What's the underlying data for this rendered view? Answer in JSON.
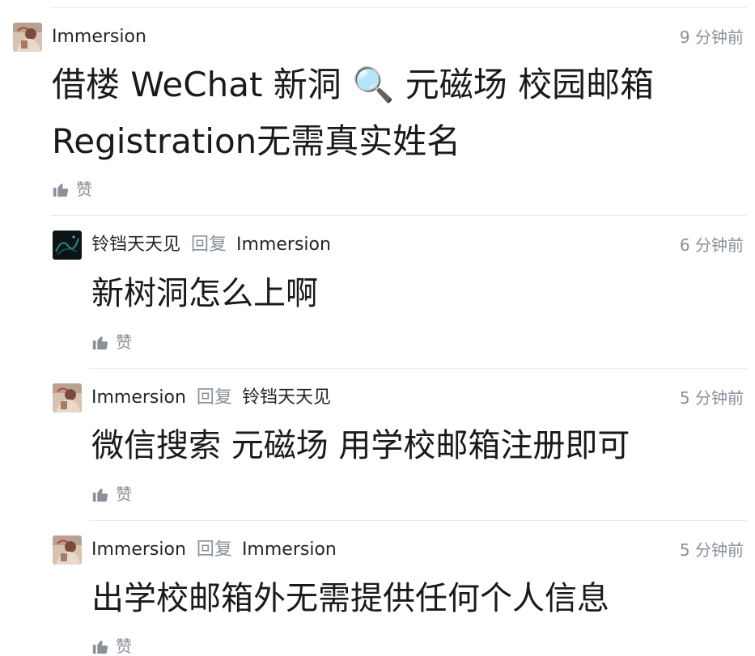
{
  "comments": [
    {
      "author": "Immersion",
      "time": "9 分钟前",
      "content_line1": "借楼 WeChat 新洞 🔍 元磁场 校园邮箱",
      "content_line2": "Registration无需真实姓名",
      "like_label": "赞",
      "avatar_icon": "person-photo-avatar"
    },
    {
      "author": "铃铛天天见",
      "reply_word": "回复",
      "reply_to": "Immersion",
      "time": "6 分钟前",
      "content": "新树洞怎么上啊",
      "like_label": "赞",
      "avatar_icon": "dark-abstract-avatar"
    },
    {
      "author": "Immersion",
      "reply_word": "回复",
      "reply_to": "铃铛天天见",
      "time": "5 分钟前",
      "content": "微信搜索 元磁场 用学校邮箱注册即可",
      "like_label": "赞",
      "avatar_icon": "person-photo-avatar"
    },
    {
      "author": "Immersion",
      "reply_word": "回复",
      "reply_to": "Immersion",
      "time": "5 分钟前",
      "content": "出学校邮箱外无需提供任何个人信息",
      "like_label": "赞",
      "avatar_icon": "person-photo-avatar"
    }
  ],
  "colors": {
    "meta_gray": "#8a8f99",
    "divider": "#ebebeb",
    "text": "#1a1a1a"
  }
}
